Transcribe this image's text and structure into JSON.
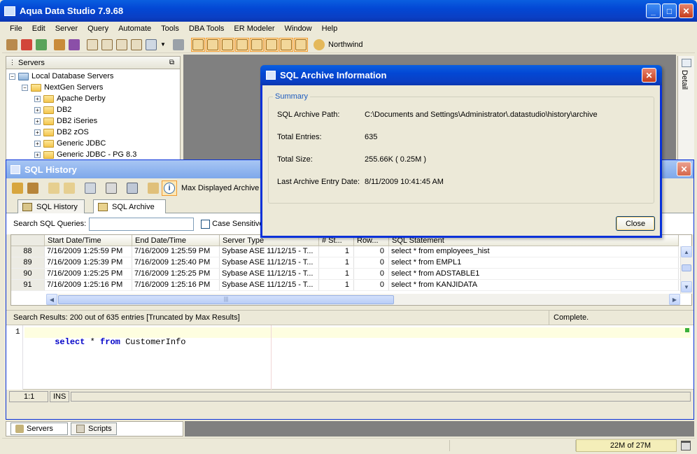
{
  "app": {
    "title": "Aqua Data Studio 7.9.68"
  },
  "menu": [
    "File",
    "Edit",
    "Server",
    "Query",
    "Automate",
    "Tools",
    "DBA Tools",
    "ER Modeler",
    "Window",
    "Help"
  ],
  "toolbar": {
    "connection": "Northwind"
  },
  "servers_panel": {
    "title": "Servers",
    "tree": [
      {
        "label": "Local Database Servers",
        "level": 0
      },
      {
        "label": "NextGen Servers",
        "level": 1
      },
      {
        "label": "Apache Derby",
        "level": 2
      },
      {
        "label": "DB2",
        "level": 2
      },
      {
        "label": "DB2 iSeries",
        "level": 2
      },
      {
        "label": "DB2 zOS",
        "level": 2
      },
      {
        "label": "Generic JDBC",
        "level": 2
      },
      {
        "label": "Generic JDBC - PG 8.3",
        "level": 2
      }
    ],
    "bottom_tabs": [
      "Servers",
      "Scripts"
    ]
  },
  "right_panel": {
    "detail_label": "Detail"
  },
  "sql_history": {
    "title": "SQL History",
    "max_displayed_label": "Max Displayed Archive Re",
    "tabs": [
      "SQL History",
      "SQL Archive"
    ],
    "search_label": "Search SQL Queries:",
    "search_value": "",
    "case_sensitive_label": "Case Sensitive",
    "columns": [
      "",
      "Start Date/Time",
      "End Date/Time",
      "Server Type",
      "# St...",
      "Row...",
      "SQL Statement"
    ],
    "rows": [
      {
        "num": "88",
        "start": "7/16/2009 1:25:59 PM",
        "end": "7/16/2009 1:25:59 PM",
        "server": "Sybase ASE 11/12/15 - T...",
        "st": "1",
        "rows": "0",
        "sql": "select * from employees_hist"
      },
      {
        "num": "89",
        "start": "7/16/2009 1:25:39 PM",
        "end": "7/16/2009 1:25:40 PM",
        "server": "Sybase ASE 11/12/15 - T...",
        "st": "1",
        "rows": "0",
        "sql": "select * from EMPL1"
      },
      {
        "num": "90",
        "start": "7/16/2009 1:25:25 PM",
        "end": "7/16/2009 1:25:25 PM",
        "server": "Sybase ASE 11/12/15 - T...",
        "st": "1",
        "rows": "0",
        "sql": "select * from ADSTABLE1"
      },
      {
        "num": "91",
        "start": "7/16/2009 1:25:16 PM",
        "end": "7/16/2009 1:25:16 PM",
        "server": "Sybase ASE 11/12/15 - T...",
        "st": "1",
        "rows": "0",
        "sql": "select * from KANJIDATA"
      }
    ],
    "status_left": "Search Results: 200 out of 635 entries [Truncated by Max Results]",
    "status_right": "Complete.",
    "editor": {
      "line_number": "1",
      "keyword1": "select",
      "op": "*",
      "keyword2": "from",
      "ident": "CustomerInfo"
    },
    "editor_status": {
      "position": "1:1",
      "mode": "INS"
    }
  },
  "archive_dialog": {
    "title": "SQL Archive Information",
    "group": "Summary",
    "fields": [
      {
        "label": "SQL Archive Path:",
        "value": "C:\\Documents and Settings\\Administrator\\.datastudio\\history\\archive"
      },
      {
        "label": "Total Entries:",
        "value": "635"
      },
      {
        "label": "Total Size:",
        "value": "255.66K ( 0.25M )"
      },
      {
        "label": "Last Archive Entry Date:",
        "value": "8/11/2009 10:41:45 AM"
      }
    ],
    "close_button": "Close"
  },
  "statusbar": {
    "memory": "22M of 27M"
  }
}
